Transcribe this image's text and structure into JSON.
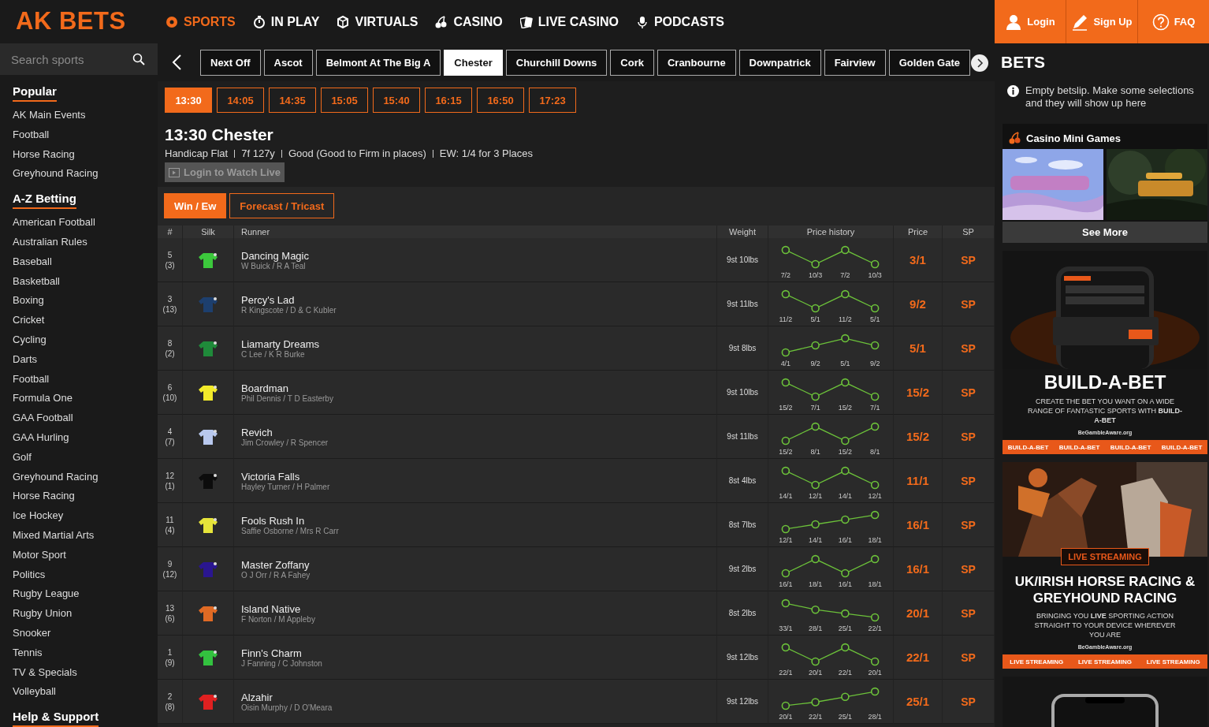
{
  "header": {
    "logo": "AK BETS",
    "nav": [
      {
        "label": "SPORTS",
        "selected": true
      },
      {
        "label": "IN PLAY",
        "selected": false
      },
      {
        "label": "VIRTUALS",
        "selected": false
      },
      {
        "label": "CASINO",
        "selected": false
      },
      {
        "label": "LIVE CASINO",
        "selected": false
      },
      {
        "label": "PODCASTS",
        "selected": false
      }
    ],
    "actions": [
      {
        "label": "Login"
      },
      {
        "label": "Sign Up"
      },
      {
        "label": "FAQ"
      }
    ]
  },
  "sidebar": {
    "search": {
      "placeholder": "Search sports"
    },
    "sections": [
      {
        "title": "Popular",
        "items": [
          "AK Main Events",
          "Football",
          "Horse Racing",
          "Greyhound Racing"
        ]
      },
      {
        "title": "A-Z Betting",
        "items": [
          "American Football",
          "Australian Rules",
          "Baseball",
          "Basketball",
          "Boxing",
          "Cricket",
          "Cycling",
          "Darts",
          "Football",
          "Formula One",
          "GAA Football",
          "GAA Hurling",
          "Golf",
          "Greyhound Racing",
          "Horse Racing",
          "Ice Hockey",
          "Mixed Martial Arts",
          "Motor Sport",
          "Politics",
          "Rugby League",
          "Rugby Union",
          "Snooker",
          "Tennis",
          "TV & Specials",
          "Volleyball"
        ]
      },
      {
        "title": "Help & Support"
      }
    ]
  },
  "venues": [
    {
      "label": "Next Off",
      "selected": false
    },
    {
      "label": "Ascot",
      "selected": false
    },
    {
      "label": "Belmont At The Big A",
      "selected": false
    },
    {
      "label": "Chester",
      "selected": true
    },
    {
      "label": "Churchill Downs",
      "selected": false
    },
    {
      "label": "Cork",
      "selected": false
    },
    {
      "label": "Cranbourne",
      "selected": false
    },
    {
      "label": "Downpatrick",
      "selected": false
    },
    {
      "label": "Fairview",
      "selected": false
    },
    {
      "label": "Golden Gate",
      "selected": false
    }
  ],
  "times": [
    {
      "label": "13:30",
      "selected": true
    },
    {
      "label": "14:05",
      "selected": false
    },
    {
      "label": "14:35",
      "selected": false
    },
    {
      "label": "15:05",
      "selected": false
    },
    {
      "label": "15:40",
      "selected": false
    },
    {
      "label": "16:15",
      "selected": false
    },
    {
      "label": "16:50",
      "selected": false
    },
    {
      "label": "17:23",
      "selected": false
    }
  ],
  "race": {
    "title": "13:30 Chester",
    "details": [
      "Handicap Flat",
      "7f 127y",
      "Good (Good to Firm in places)",
      "EW: 1/4  for 3 Places"
    ],
    "watch": "Login to Watch Live"
  },
  "market_tabs": [
    {
      "label": "Win / Ew",
      "selected": true
    },
    {
      "label": "Forecast / Tricast",
      "selected": false
    }
  ],
  "table": {
    "columns": [
      "#",
      "Silk",
      "Runner",
      "Weight",
      "Price history",
      "Price",
      "SP"
    ],
    "rows": [
      {
        "number": "5",
        "draw": "(3)",
        "color": "#3cc83c",
        "runner": "Dancing Magic",
        "connections": "W Buick / R A Teal",
        "weight": "9st 10lbs",
        "history": [
          "7/2",
          "10/3",
          "7/2",
          "10/3"
        ],
        "price": "3/1",
        "sp": "SP"
      },
      {
        "number": "3",
        "draw": "(13)",
        "color": "#1d3f6e",
        "runner": "Percy's Lad",
        "connections": "R Kingscote / D & C Kubler",
        "weight": "9st 11lbs",
        "history": [
          "11/2",
          "5/1",
          "11/2",
          "5/1"
        ],
        "price": "9/2",
        "sp": "SP"
      },
      {
        "number": "8",
        "draw": "(2)",
        "color": "#1f8a3a",
        "runner": "Liamarty Dreams",
        "connections": "C Lee / K R Burke",
        "weight": "9st 8lbs",
        "history": [
          "4/1",
          "9/2",
          "5/1",
          "9/2"
        ],
        "price": "5/1",
        "sp": "SP"
      },
      {
        "number": "6",
        "draw": "(10)",
        "color": "#f2ea2a",
        "runner": "Boardman",
        "connections": "Phil Dennis / T D Easterby",
        "weight": "9st 10lbs",
        "history": [
          "15/2",
          "7/1",
          "15/2",
          "7/1"
        ],
        "price": "15/2",
        "sp": "SP"
      },
      {
        "number": "4",
        "draw": "(7)",
        "color": "#b8c8ee",
        "runner": "Revich",
        "connections": "Jim Crowley / R Spencer",
        "weight": "9st 11lbs",
        "history": [
          "15/2",
          "8/1",
          "15/2",
          "8/1"
        ],
        "price": "15/2",
        "sp": "SP"
      },
      {
        "number": "12",
        "draw": "(1)",
        "color": "#0c0c0c",
        "runner": "Victoria Falls",
        "connections": "Hayley Turner / H Palmer",
        "weight": "8st 4lbs",
        "history": [
          "14/1",
          "12/1",
          "14/1",
          "12/1"
        ],
        "price": "11/1",
        "sp": "SP"
      },
      {
        "number": "11",
        "draw": "(4)",
        "color": "#e6e43a",
        "runner": "Fools Rush In",
        "connections": "Saffie Osborne / Mrs R Carr",
        "weight": "8st 7lbs",
        "history": [
          "12/1",
          "14/1",
          "16/1",
          "18/1"
        ],
        "price": "16/1",
        "sp": "SP"
      },
      {
        "number": "9",
        "draw": "(12)",
        "color": "#2a1690",
        "runner": "Master Zoffany",
        "connections": "O J Orr / R A Fahey",
        "weight": "9st 2lbs",
        "history": [
          "16/1",
          "18/1",
          "16/1",
          "18/1"
        ],
        "price": "16/1",
        "sp": "SP"
      },
      {
        "number": "13",
        "draw": "(6)",
        "color": "#e06a24",
        "runner": "Island Native",
        "connections": "F Norton / M Appleby",
        "weight": "8st 2lbs",
        "history": [
          "33/1",
          "28/1",
          "25/1",
          "22/1"
        ],
        "price": "20/1",
        "sp": "SP"
      },
      {
        "number": "1",
        "draw": "(9)",
        "color": "#33c23f",
        "runner": "Finn's Charm",
        "connections": "J Fanning / C Johnston",
        "weight": "9st 12lbs",
        "history": [
          "22/1",
          "20/1",
          "22/1",
          "20/1"
        ],
        "price": "22/1",
        "sp": "SP"
      },
      {
        "number": "2",
        "draw": "(8)",
        "color": "#e02020",
        "runner": "Alzahir",
        "connections": "Oisin Murphy / D O'Meara",
        "weight": "9st 12lbs",
        "history": [
          "20/1",
          "22/1",
          "25/1",
          "28/1"
        ],
        "price": "25/1",
        "sp": "SP"
      }
    ]
  },
  "betslip": {
    "title": "BETS",
    "message": "Empty betslip. Make some selections and they will show up here",
    "casino": {
      "title": "Casino Mini Games",
      "see_more": "See More"
    },
    "banners": [
      {
        "kind": "build",
        "headline": "BUILD-A-BET",
        "body": "CREATE THE BET YOU WANT ON A WIDE RANGE OF FANTASTIC SPORTS WITH **BUILD-A-BET**",
        "footer": "BeGambleAware.org",
        "strip": [
          "BUILD-A-BET",
          "BUILD-A-BET",
          "BUILD-A-BET",
          "BUILD-A-BET"
        ]
      },
      {
        "kind": "stream",
        "tag": "LIVE STREAMING",
        "headline": "UK/IRISH HORSE RACING & GREYHOUND RACING",
        "body": "BRINGING YOU **LIVE** SPORTING ACTION STRAIGHT TO YOUR DEVICE WHEREVER YOU ARE",
        "footer": "BeGambleAware.org",
        "strip": [
          "LIVE STREAMING",
          "LIVE STREAMING",
          "LIVE STREAMING"
        ]
      },
      {
        "kind": "phone"
      }
    ]
  }
}
